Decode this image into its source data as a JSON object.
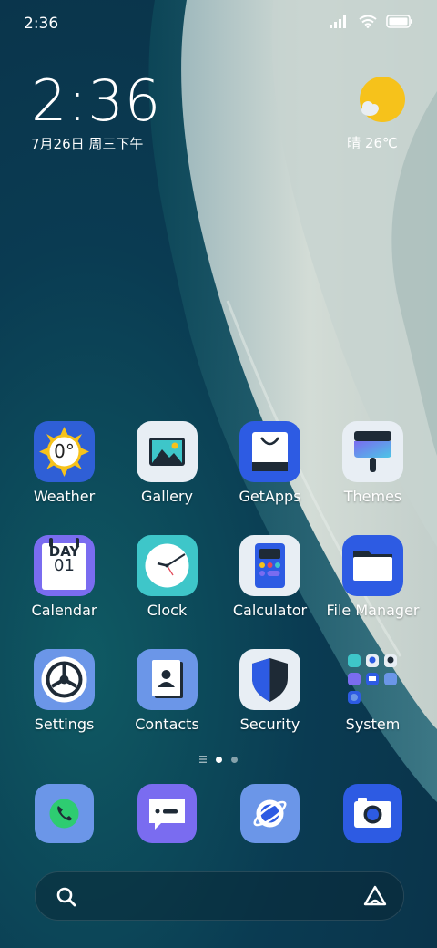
{
  "status_bar": {
    "time": "2:36"
  },
  "clock_widget": {
    "time": "2:36",
    "date": "7月26日 周三下午"
  },
  "weather_widget": {
    "condition": "晴",
    "temperature": "26℃"
  },
  "apps": [
    [
      {
        "label": "Weather",
        "icon": "weather-icon",
        "badge_text": "0°"
      },
      {
        "label": "Gallery",
        "icon": "gallery-icon"
      },
      {
        "label": "GetApps",
        "icon": "getapps-icon"
      },
      {
        "label": "Themes",
        "icon": "themes-icon"
      }
    ],
    [
      {
        "label": "Calendar",
        "icon": "calendar-icon",
        "day_word": "DAY",
        "day_num": "01"
      },
      {
        "label": "Clock",
        "icon": "clock-icon"
      },
      {
        "label": "Calculator",
        "icon": "calculator-icon"
      },
      {
        "label": "File Manager",
        "icon": "file-manager-icon"
      }
    ],
    [
      {
        "label": "Settings",
        "icon": "settings-icon"
      },
      {
        "label": "Contacts",
        "icon": "contacts-icon"
      },
      {
        "label": "Security",
        "icon": "security-icon"
      },
      {
        "label": "System",
        "icon": "system-folder-icon"
      }
    ]
  ],
  "page_indicator": {
    "pages": 2,
    "current": 1
  },
  "dock": [
    {
      "icon": "phone-icon"
    },
    {
      "icon": "messages-icon"
    },
    {
      "icon": "browser-icon"
    },
    {
      "icon": "camera-icon"
    }
  ],
  "colors": {
    "weather_bg": "#2f5fd6",
    "sun": "#f6c21b",
    "blue_icon": "#2d5be3",
    "light_icon": "#e8eef4",
    "accent_cyan": "#3ec6c9"
  }
}
